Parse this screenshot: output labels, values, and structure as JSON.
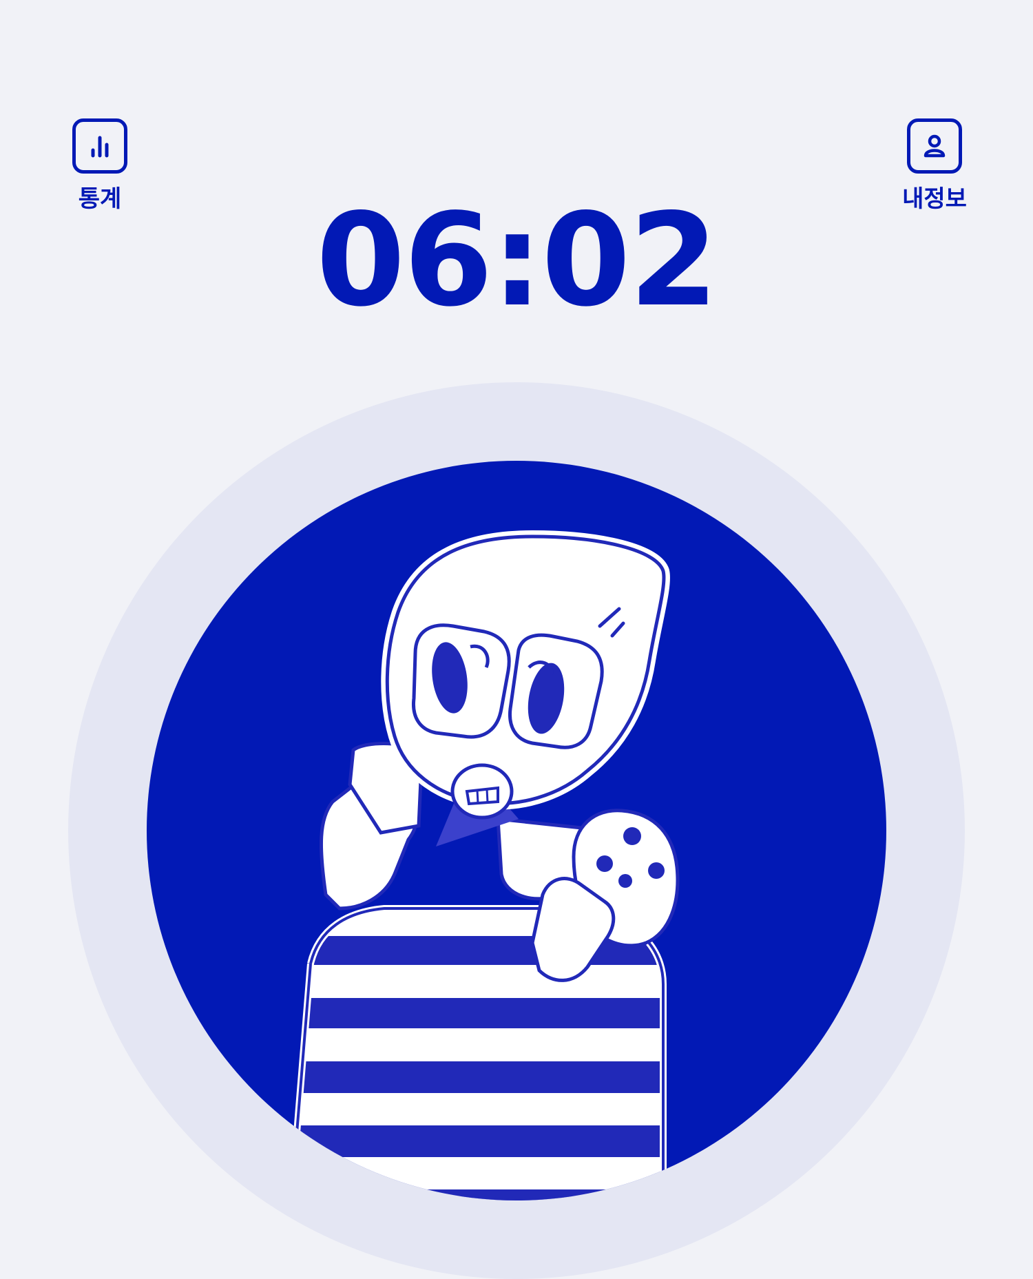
{
  "nav": {
    "stats": {
      "label": "통계",
      "icon": "bar-chart-icon"
    },
    "profile": {
      "label": "내정보",
      "icon": "user-icon"
    }
  },
  "timer": {
    "value": "06:02"
  },
  "character": {
    "icon": "character-illustration"
  },
  "colors": {
    "primary": "#0219b5",
    "background": "#f1f2f7",
    "ring": "#e4e6f3",
    "stripe": "#2129b8"
  }
}
